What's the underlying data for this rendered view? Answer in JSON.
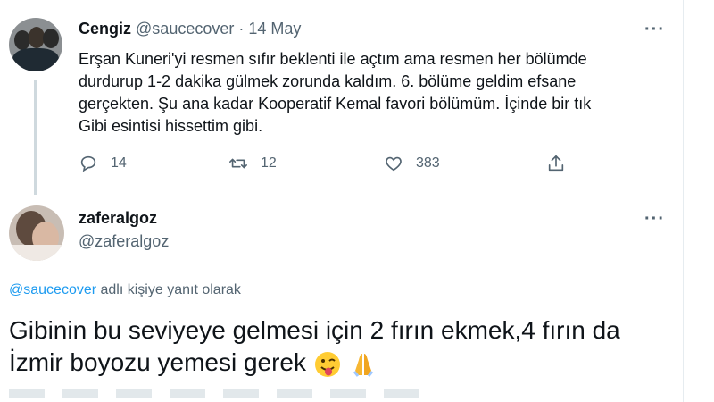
{
  "tweet": {
    "author_name": "Cengiz",
    "author_handle": "@saucecover",
    "separator": "·",
    "date": "14 May",
    "more_label": "···",
    "text_lines": [
      "Erşan Kuneri'yi resmen sıfır beklenti ile açtım ama resmen her bölümde",
      "durdurup 1-2 dakika gülmek zorunda kaldım. 6. bölüme geldim efsane",
      "gerçekten. Şu ana kadar Kooperatif Kemal favori bölümüm. İçinde bir tık",
      "Gibi esintisi hissettim gibi."
    ],
    "actions": {
      "reply_count": "14",
      "retweet_count": "12",
      "like_count": "383"
    }
  },
  "reply": {
    "author_name": "zaferalgoz",
    "author_handle": "@zaferalgoz",
    "more_label": "···",
    "replying_handle": "@saucecover",
    "replying_suffix": " adlı kişiye yanıt olarak",
    "text_lines": [
      "Gibinin bu seviyeye gelmesi için 2 fırın ekmek,4 fırın da",
      "İzmir boyozu yemesi gerek"
    ],
    "emojis": [
      "winking-face-with-tongue",
      "folded-hands"
    ]
  },
  "colors": {
    "accent": "#1d9bf0",
    "text": "#0f1419",
    "muted": "#536471",
    "line": "#cfd9de"
  }
}
